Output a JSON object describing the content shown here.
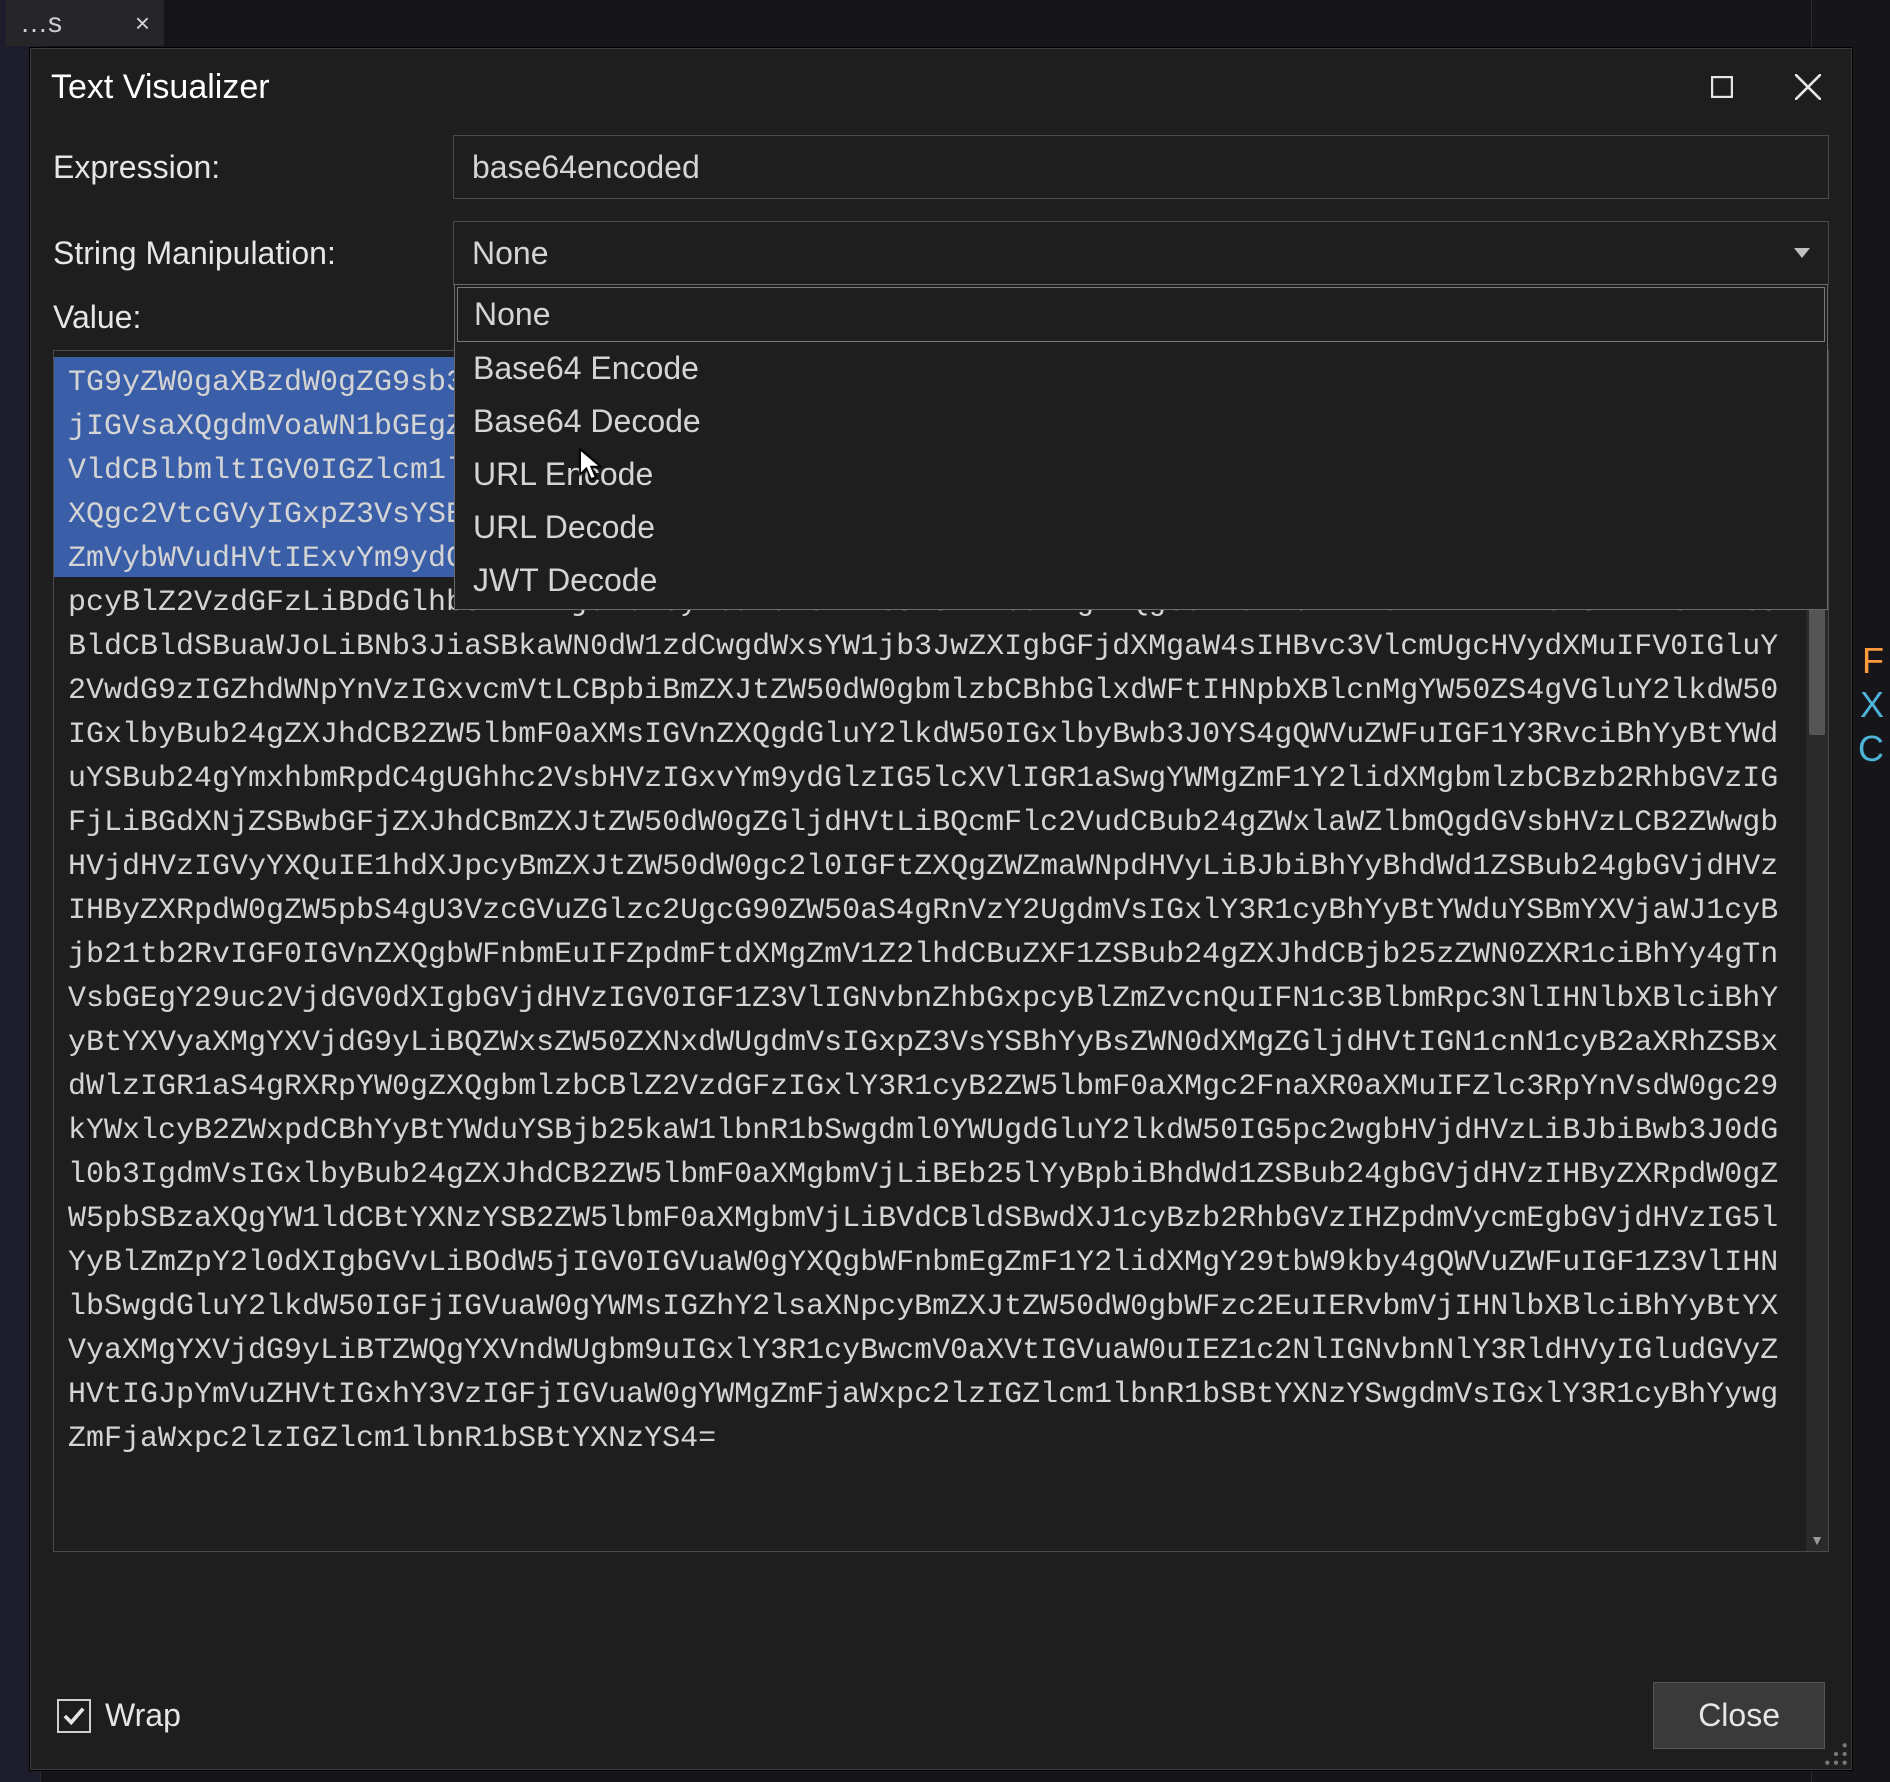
{
  "backdrop": {
    "tab_label": "…s",
    "tab_close": "×",
    "right_tokens": {
      "r1": "F",
      "r2": "X",
      "r3": "C"
    }
  },
  "dialog": {
    "title": "Text Visualizer",
    "expression_label": "Expression:",
    "expression_value": "base64encoded",
    "manipulation_label": "String Manipulation:",
    "manipulation_selected": "None",
    "dropdown_items": [
      "None",
      "Base64 Encode",
      "Base64 Decode",
      "URL Encode",
      "URL Decode",
      "JWT Decode"
    ],
    "value_label": "Value:",
    "value_text": "TG9yZW0gaXBzdW0gZG9sb3Igc2l0IGFtZXQsIGNvbnNlY3RldHVyIGFkaXBpc2NpbmcgZWxpdC4gTmFtIG5lYyBudW5jIGFjIGVsaXQgdmVoaWN1bGEgZWxlaWZlbmQgbm9uIGF0IHR1cnBpcy4gUGhhc2VsbHVzIGVnZXQgZG9sb3IuIER1aXMgbGFvcmVldCBlbmltIGV0IGZlcm1lbnR1bSB2ZW5lbmF0aXMuIER1aXMgbG9ib3J0aXMgcXVhbSB2ZWwgbGFjdXMgcG9ydGEsIGVnZXQgc2VtcGVyIGxpZ3VsYSBzb2xsaWNpdHVkaW4uIE51bGxhbSBibGFuZGl0IG5lcXVlIHZlbCBleCBtYXhpbXVzLCBub24gZmVybWVudHVtIExvYm9ydGlzLiBVdCBmYWNpbGlzaXMgbGFjdXMgdWx0cmljZXMuIE1hZWNlbmFzIGZhbWVzIGFjIHR1cnBpcyBlZ2VzdGFzLiBDdGlhbSBmYXVjaWJ1cyBCaWJlbmR1bSBsZWN0dXMgZXQgbGFxdWF0LiBEdWlzY1VlIGVsZW1lbnR1bSBldCBldSBuaWJoLiBNb3JiaSBkaWN0dW1zdCwgdWxsYW1jb3JwZXIgbGFjdXMgaW4sIHBvc3VlcmUgcHVydXMuIFV0IGluY2VwdG9zIGZhdWNpYnVzIGxvcmVtLCBpbiBmZXJtZW50dW0gbmlzbCBhbGlxdWFtIHNpbXBlcnMgYW50ZS4gVGluY2lkdW50IGxlbyBub24gZXJhdCB2ZW5lbmF0aXMsIGVnZXQgdGluY2lkdW50IGxlbyBwb3J0YS4gQWVuZWFuIGF1Y3RvciBhYyBtYWduYSBub24gYmxhbmRpdC4gUGhhc2VsbHVzIGxvYm9ydGlzIG5lcXVlIGR1aSwgYWMgZmF1Y2lidXMgbmlzbCBzb2RhbGVzIGFjLiBGdXNjZSBwbGFjZXJhdCBmZXJtZW50dW0gZGljdHVtLiBQcmFlc2VudCBub24gZWxlaWZlbmQgdGVsbHVzLCB2ZWwgbHVjdHVzIGVyYXQuIE1hdXJpcyBmZXJtZW50dW0gc2l0IGFtZXQgZWZmaWNpdHVyLiBJbiBhYyBhdWd1ZSBub24gbGVjdHVzIHByZXRpdW0gZW5pbS4gU3VzcGVuZGlzc2UgcG90ZW50aS4gRnVzY2UgdmVsIGxlY3R1cyBhYyBtYWduYSBmYXVjaWJ1cyBjb21tb2RvIGF0IGVnZXQgbWFnbmEuIFZpdmFtdXMgZmV1Z2lhdCBuZXF1ZSBub24gZXJhdCBjb25zZWN0ZXR1ciBhYy4gTnVsbGEgY29uc2VjdGV0dXIgbGVjdHVzIGV0IGF1Z3VlIGNvbnZhbGxpcyBlZmZvcnQuIFN1c3BlbmRpc3NlIHNlbXBlciBhYyBtYXVyaXMgYXVjdG9yLiBQZWxsZW50ZXNxdWUgdmVsIGxpZ3VsYSBhYyBsZWN0dXMgZGljdHVtIGN1cnN1cyB2aXRhZSBxdWlzIGR1aS4gRXRpYW0gZXQgbmlzbCBlZ2VzdGFzIGxlY3R1cyB2ZW5lbmF0aXMgc2FnaXR0aXMuIFZlc3RpYnVsdW0gc29kYWxlcyB2ZWxpdCBhYyBtYWduYSBjb25kaW1lbnR1bSwgdml0YWUgdGluY2lkdW50IG5pc2wgbHVjdHVzLiBJbiBwb3J0dGl0b3IgdmVsIGxlbyBub24gZXJhdCB2ZW5lbmF0aXMgbmVjLiBEb25lYyBpbiBhdWd1ZSBub24gbGVjdHVzIHByZXRpdW0gZW5pbSBzaXQgYW1ldCBtYXNzYSB2ZW5lbmF0aXMgbmVjLiBVdCBldSBwdXJ1cyBzb2RhbGVzIHZpdmVycmEgbGVjdHVzIG5lYyBlZmZpY2l0dXIgbGVvLiBOdW5jIGV0IGVuaW0gYXQgbWFnbmEgZmF1Y2lidXMgY29tbW9kby4gQWVuZWFuIGF1Z3VlIHNlbSwgdGluY2lkdW50IGFjIGVuaW0gYWMsIGZhY2lsaXNpcyBmZXJtZW50dW0gbWFzc2EuIERvbmVjIHNlbXBlciBhYyBtYXVyaXMgYXVjdG9yLiBTZWQgYXVndWUgbm9uIGxlY3R1cyBwcmV0aXVtIGVuaW0uIEZ1c2NlIGNvbnNlY3RldHVyIGludGVyZHVtIGJpYmVuZHVtIGxhY3VzIGFjIGVuaW0gYWMgZmFjaWxpc2lzIGZlcm1lbnR1bSBtYXNzYSwgdmVsIGxlY3R1cyBhYywgZmFjaWxpc2lzIGZlcm1lbnR1bSBtYXNzYS4=",
    "wrap_label": "Wrap",
    "wrap_checked": true,
    "close_button": "Close"
  },
  "colors": {
    "dialog_bg": "#1e1e1e",
    "border": "#4a4a4a",
    "text": "#e6e6e6",
    "selection": "#3a5fa8"
  }
}
